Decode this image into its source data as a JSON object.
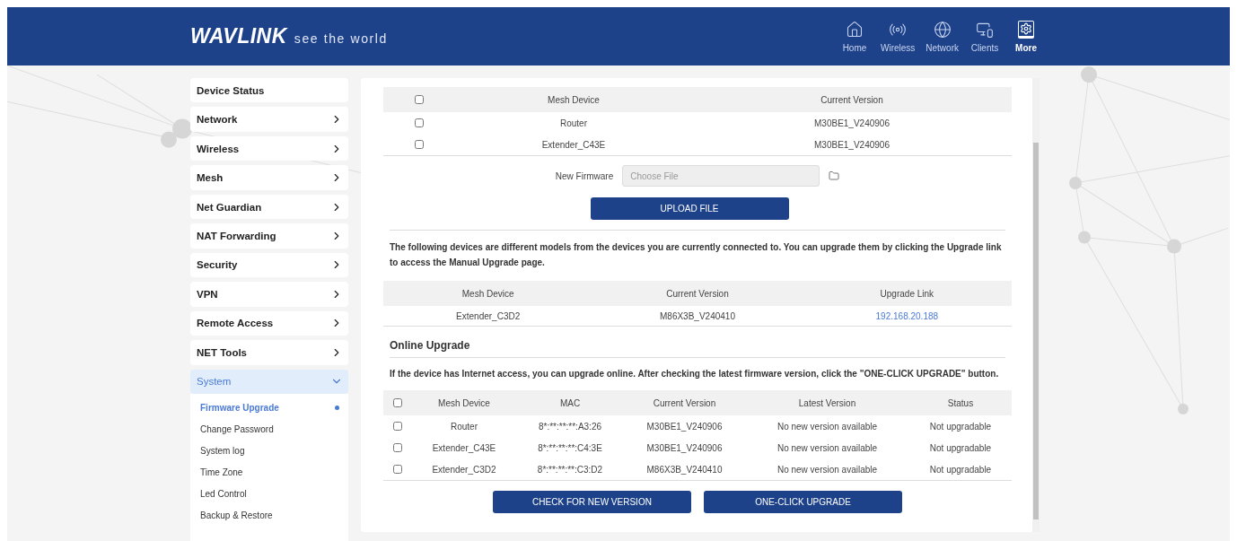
{
  "header": {
    "brand": "WAVLINK",
    "tagline": "see the world",
    "nav": [
      {
        "label": "Home",
        "selected": false
      },
      {
        "label": "Wireless",
        "selected": false
      },
      {
        "label": "Network",
        "selected": false
      },
      {
        "label": "Clients",
        "selected": false
      },
      {
        "label": "More",
        "selected": true
      }
    ]
  },
  "sidebar": {
    "items": [
      {
        "label": "Device Status",
        "kind": "link"
      },
      {
        "label": "Network",
        "kind": "group",
        "expanded": false
      },
      {
        "label": "Wireless",
        "kind": "group",
        "expanded": false
      },
      {
        "label": "Mesh",
        "kind": "group",
        "expanded": false
      },
      {
        "label": "Net Guardian",
        "kind": "group",
        "expanded": false
      },
      {
        "label": "NAT Forwarding",
        "kind": "group",
        "expanded": false
      },
      {
        "label": "Security",
        "kind": "group",
        "expanded": false
      },
      {
        "label": "VPN",
        "kind": "group",
        "expanded": false
      },
      {
        "label": "Remote Access",
        "kind": "group",
        "expanded": false
      },
      {
        "label": "NET Tools",
        "kind": "group",
        "expanded": false
      },
      {
        "label": "System",
        "kind": "group",
        "expanded": true,
        "children": [
          {
            "label": "Firmware Upgrade",
            "selected": true
          },
          {
            "label": "Change Password",
            "selected": false
          },
          {
            "label": "System log",
            "selected": false
          },
          {
            "label": "Time Zone",
            "selected": false
          },
          {
            "label": "Led Control",
            "selected": false
          },
          {
            "label": "Backup & Restore",
            "selected": false
          }
        ]
      }
    ]
  },
  "firmware_table": {
    "all_checked": false,
    "columns": [
      "Mesh Device",
      "Current Version"
    ],
    "rows": [
      {
        "checked": false,
        "cells": [
          "Router",
          "M30BE1_V240906"
        ]
      },
      {
        "checked": false,
        "cells": [
          "Extender_C43E",
          "M30BE1_V240906"
        ]
      }
    ]
  },
  "upload": {
    "label": "New Firmware",
    "placeholder": "Choose File",
    "button": "UPLOAD FILE"
  },
  "notice": "The following devices are different models from the devices you are currently connected to. You can upgrade them by clicking the Upgrade link to access the Manual Upgrade page.",
  "manual_table": {
    "columns": [
      "Mesh Device",
      "Current Version",
      "Upgrade Link"
    ],
    "rows": [
      {
        "cells": [
          "Extender_C3D2",
          "M86X3B_V240410"
        ],
        "link": "192.168.20.188"
      }
    ]
  },
  "online_upgrade": {
    "title": "Online Upgrade",
    "description": "If the device has Internet access, you can upgrade online. After checking the latest firmware version, click the \"ONE-CLICK UPGRADE\" button.",
    "all_checked": false,
    "columns": [
      "Mesh Device",
      "MAC",
      "Current Version",
      "Latest Version",
      "Status"
    ],
    "rows": [
      {
        "checked": false,
        "cells": [
          "Router",
          "8*:**:**:**:A3:26",
          "M30BE1_V240906",
          "No new version available",
          "Not upgradable"
        ]
      },
      {
        "checked": false,
        "cells": [
          "Extender_C43E",
          "8*:**:**:**:C4:3E",
          "M30BE1_V240906",
          "No new version available",
          "Not upgradable"
        ]
      },
      {
        "checked": false,
        "cells": [
          "Extender_C3D2",
          "8*:**:**:**:C3:D2",
          "M86X3B_V240410",
          "No new version available",
          "Not upgradable"
        ]
      }
    ],
    "buttons": [
      "CHECK FOR NEW VERSION",
      "ONE-CLICK UPGRADE"
    ]
  }
}
